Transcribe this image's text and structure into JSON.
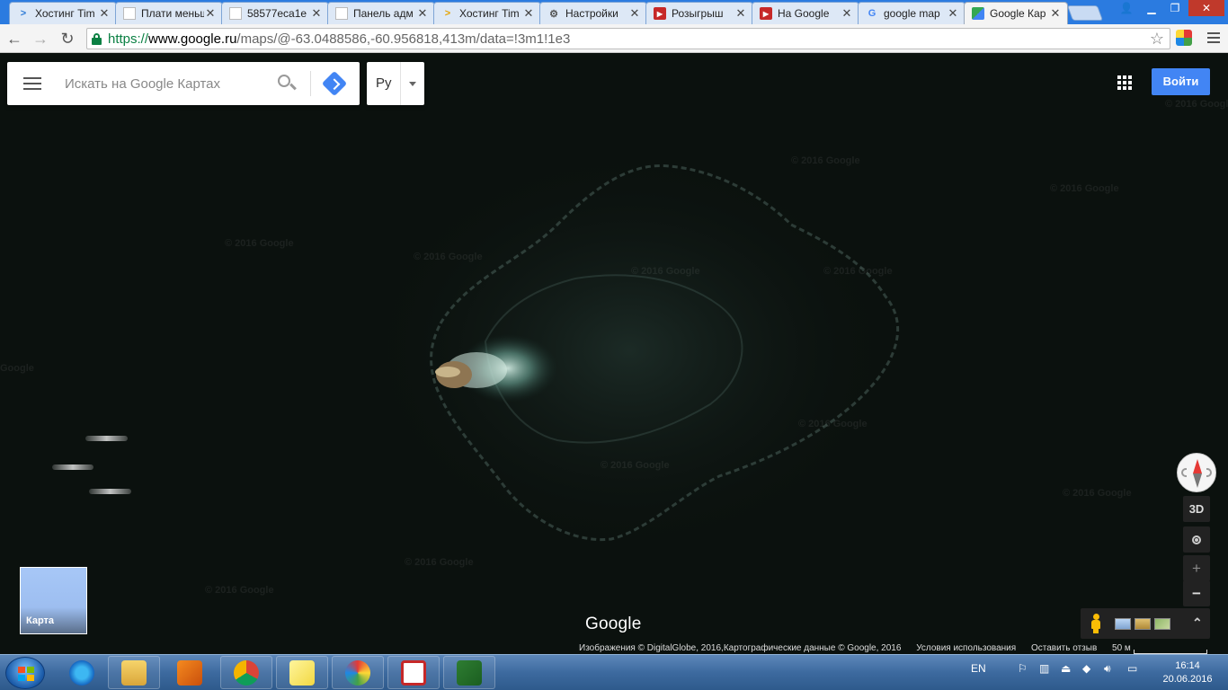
{
  "browser": {
    "tabs": [
      {
        "title": "Хостинг Tim",
        "icon": "timeweb-chevron-icon"
      },
      {
        "title": "Плати меньше",
        "icon": "blank-page-icon"
      },
      {
        "title": "58577eca1e",
        "icon": "blank-page-icon"
      },
      {
        "title": "Панель адм",
        "icon": "blank-page-icon"
      },
      {
        "title": "Хостинг Tim",
        "icon": "timeweb-chevron-icon"
      },
      {
        "title": "Настройки",
        "icon": "gear-icon"
      },
      {
        "title": "Розыгрыш",
        "icon": "youtube-icon"
      },
      {
        "title": "На Google",
        "icon": "youtube-icon"
      },
      {
        "title": "google map",
        "icon": "google-g-icon"
      },
      {
        "title": "Google Кар",
        "icon": "google-maps-icon",
        "active": true
      }
    ],
    "url": {
      "scheme": "https://",
      "host": "www.google.ru",
      "path": "/maps/@-63.0488586,-60.956818,413m/data=!3m1!1e3"
    }
  },
  "maps": {
    "search_placeholder": "Искать на Google Картах",
    "language": "Ру",
    "sign_in": "Войти",
    "btn_3d": "3D",
    "zoom_in": "+",
    "zoom_out": "−",
    "minimap_label": "Карта",
    "logo": "Google",
    "watermark": "© 2016 Google",
    "watermark_partial": "Google",
    "attribution": "Изображения © DigitalGlobe, 2016,Картографические данные © Google, 2016",
    "terms": "Условия использования",
    "feedback": "Оставить отзыв",
    "scale": "50 м"
  },
  "taskbar": {
    "lang": "EN",
    "time": "16:14",
    "date": "20.06.2016"
  }
}
